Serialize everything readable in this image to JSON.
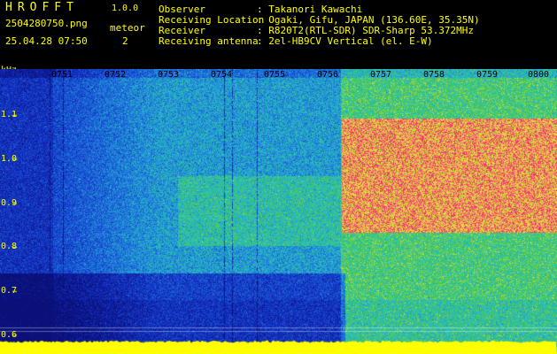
{
  "app": {
    "name": "HROFFT",
    "version": "1.0.0"
  },
  "file": {
    "name": "2504280750.png",
    "datetime": "25.04.28 07:50"
  },
  "meteor": {
    "label": "meteor",
    "count": "2"
  },
  "info": [
    {
      "key": "Observer",
      "value": ": Takanori Kawachi"
    },
    {
      "key": "Receiving Location",
      "value": ": Ogaki, Gifu, JAPAN (136.60E, 35.35N)"
    },
    {
      "key": "Receiver",
      "value": ": R820T2(RTL-SDR) SDR-Sharp 53.372MHz"
    },
    {
      "key": "Receiving antenna",
      "value": ": 2el-HB9CV Vertical (el. E-W)"
    }
  ],
  "spectrogram": {
    "y_unit": "kHz",
    "y_ticks": [
      "1.1",
      "1.0",
      "0.9",
      "0.8",
      "0.7",
      "0.6"
    ],
    "x_ticks": [
      "0751",
      "0752",
      "0753",
      "0754",
      "0755",
      "0756",
      "0757",
      "0758",
      "0759",
      "0800"
    ],
    "colors": {
      "text": "#ffff00",
      "noise_floor": "#ffff00",
      "background": "#000000"
    }
  }
}
